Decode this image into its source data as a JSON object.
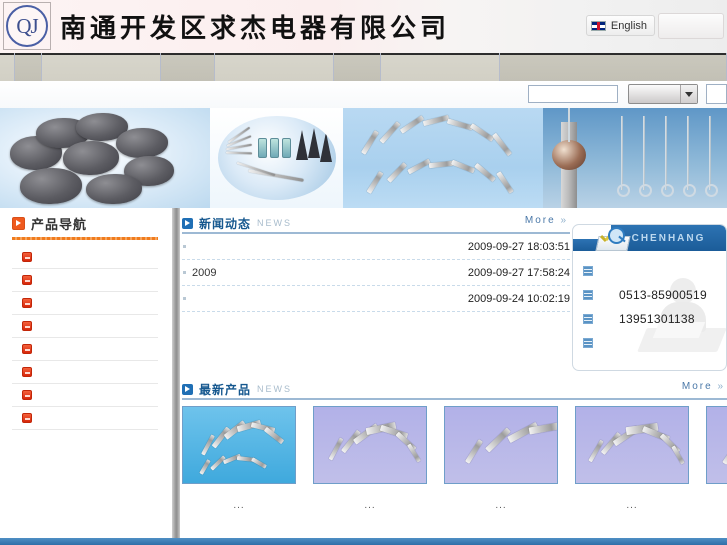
{
  "header": {
    "logo_text": "QJ",
    "company_title": "南通开发区求杰电器有限公司",
    "language_button": "English",
    "flag_icon": "uk-flag-icon",
    "blank_button_label": ""
  },
  "nav": {
    "items": [
      {
        "label": ""
      },
      {
        "label": ""
      },
      {
        "label": ""
      },
      {
        "label": ""
      },
      {
        "label": ""
      },
      {
        "label": ""
      },
      {
        "label": ""
      },
      {
        "label": ""
      }
    ]
  },
  "search": {
    "value": "",
    "placeholder": "",
    "selected_option": "",
    "options": [
      ""
    ],
    "extra_value": ""
  },
  "banner": {
    "slides": [
      {
        "alt": "metal-blanks-photo"
      },
      {
        "alt": "instrument-set-photo"
      },
      {
        "alt": "metal-pins-photo"
      },
      {
        "alt": "tower-and-hooks-photo"
      }
    ]
  },
  "sidebar": {
    "title": "产品导航",
    "items": [
      {
        "label": ""
      },
      {
        "label": ""
      },
      {
        "label": ""
      },
      {
        "label": ""
      },
      {
        "label": ""
      },
      {
        "label": ""
      },
      {
        "label": ""
      },
      {
        "label": ""
      }
    ]
  },
  "news": {
    "title_cn": "新闻动态",
    "title_en": "NEWS",
    "more_label": "More",
    "more_chevron": "»",
    "rows": [
      {
        "title": "",
        "date": "2009-09-27 18:03:51"
      },
      {
        "title": "2009",
        "date": "2009-09-27 17:58:24"
      },
      {
        "title": "",
        "date": "2009-09-24 10:02:19"
      }
    ]
  },
  "contact": {
    "tab_title": "CHENHANG",
    "icon": "book-search-icon",
    "rows": [
      {
        "value": ""
      },
      {
        "value": "0513-85900519"
      },
      {
        "value": "13951301138"
      },
      {
        "value": ""
      }
    ]
  },
  "products": {
    "title_cn": "最新产品",
    "title_en": "NEWS",
    "more_label": "More",
    "more_chevron": "»",
    "items": [
      {
        "caption": "...",
        "alt": "pins-blue-photo"
      },
      {
        "caption": "...",
        "alt": "pins-violet-photo-1"
      },
      {
        "caption": "...",
        "alt": "pins-violet-photo-2"
      },
      {
        "caption": "...",
        "alt": "pins-violet-photo-3"
      },
      {
        "caption": "...",
        "alt": "pins-violet-photo-4"
      }
    ]
  },
  "colors": {
    "accent_orange": "#ef5a1e",
    "accent_blue": "#1f6fb5",
    "footer_blue": "#3f7fb6"
  }
}
